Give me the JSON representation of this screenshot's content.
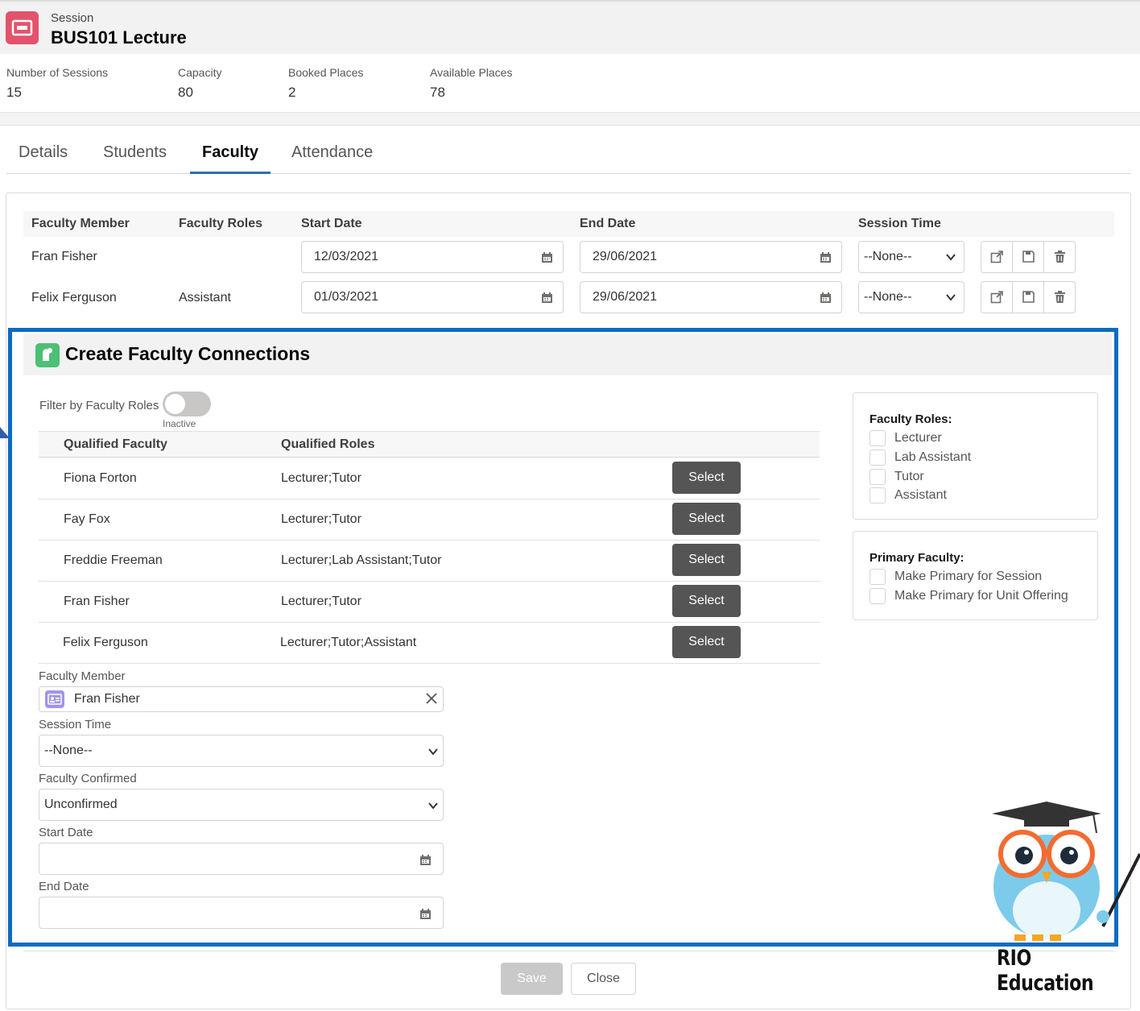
{
  "header": {
    "record_type": "Session",
    "title": "BUS101 Lecture",
    "highlights": [
      {
        "label": "Number of Sessions",
        "value": "15"
      },
      {
        "label": "Capacity",
        "value": "80"
      },
      {
        "label": "Booked Places",
        "value": "2"
      },
      {
        "label": "Available Places",
        "value": "78"
      }
    ]
  },
  "tabs": [
    {
      "label": "Details"
    },
    {
      "label": "Students"
    },
    {
      "label": "Faculty",
      "active": true
    },
    {
      "label": "Attendance"
    }
  ],
  "faculty_table": {
    "columns": [
      "Faculty Member",
      "Faculty Roles",
      "Start Date",
      "End Date",
      "Session Time"
    ],
    "rows": [
      {
        "member": "Fran Fisher",
        "roles": "",
        "start": "12/03/2021",
        "end": "29/06/2021",
        "session_time": "--None--"
      },
      {
        "member": "Felix Ferguson",
        "roles": "Assistant",
        "start": "01/03/2021",
        "end": "29/06/2021",
        "session_time": "--None--"
      }
    ]
  },
  "connections": {
    "title": "Create Faculty Connections",
    "filter_label": "Filter by Faculty Roles",
    "filter_state": "Inactive",
    "columns": [
      "Qualified Faculty",
      "Qualified Roles"
    ],
    "select_label": "Select",
    "rows": [
      {
        "name": "Fiona Forton",
        "roles": "Lecturer;Tutor"
      },
      {
        "name": "Fay Fox",
        "roles": "Lecturer;Tutor"
      },
      {
        "name": "Freddie Freeman",
        "roles": "Lecturer;Lab Assistant;Tutor"
      },
      {
        "name": "Fran Fisher",
        "roles": "Lecturer;Tutor"
      },
      {
        "name": "Felix Ferguson",
        "roles": "Lecturer;Tutor;Assistant"
      }
    ],
    "form": {
      "faculty_member_label": "Faculty Member",
      "faculty_member_value": "Fran Fisher",
      "session_time_label": "Session Time",
      "session_time_value": "--None--",
      "confirmed_label": "Faculty Confirmed",
      "confirmed_value": "Unconfirmed",
      "start_date_label": "Start Date",
      "end_date_label": "End Date"
    },
    "roles_card": {
      "title": "Faculty Roles:",
      "options": [
        "Lecturer",
        "Lab Assistant",
        "Tutor",
        "Assistant"
      ]
    },
    "primary_card": {
      "title": "Primary Faculty:",
      "options": [
        "Make Primary for Session",
        "Make Primary for Unit Offering"
      ]
    }
  },
  "footer": {
    "save_label": "Save",
    "close_label": "Close"
  },
  "branding": {
    "logo_text": "RIO Education"
  },
  "colors": {
    "frame_blue": "#0b6cc0",
    "select_button": "#555555",
    "session_icon": "#e3536b",
    "connections_icon": "#4bc076"
  }
}
